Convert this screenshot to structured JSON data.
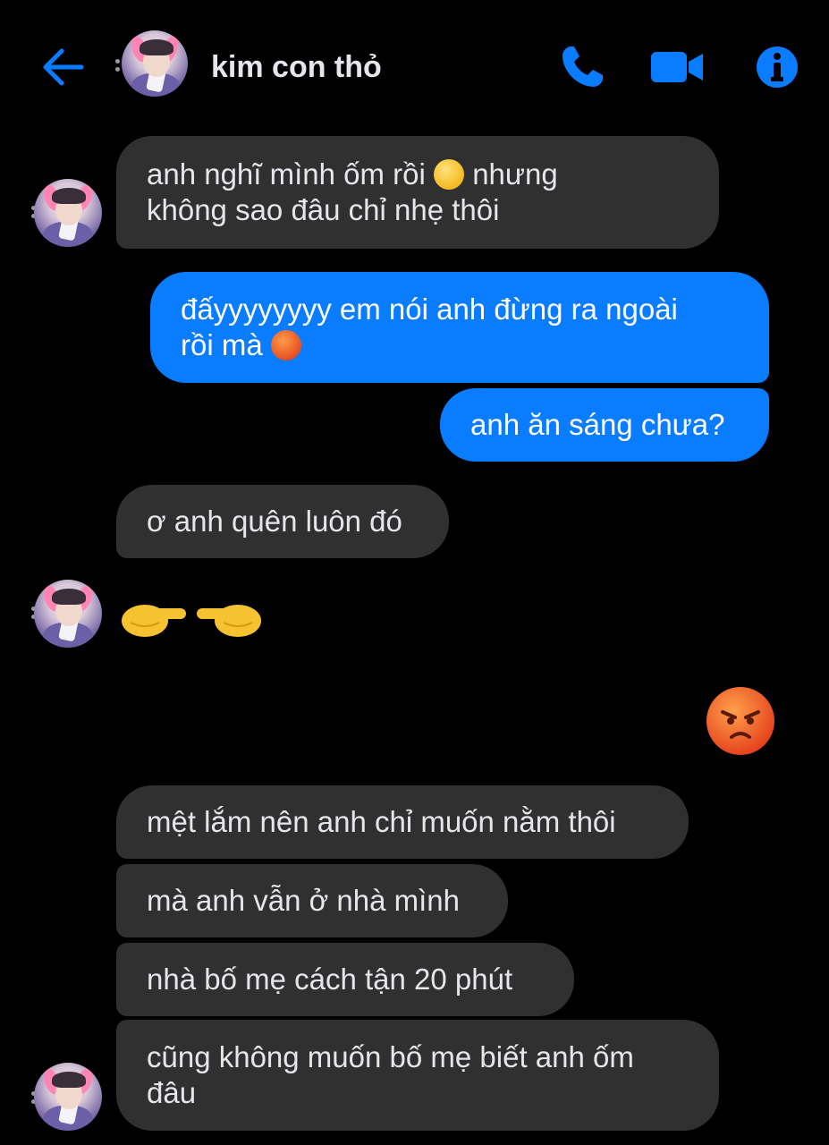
{
  "header": {
    "contact_name": "kim con thỏ",
    "accent_color": "#0a7cff",
    "icons": [
      "back-arrow-icon",
      "phone-icon",
      "video-camera-icon",
      "info-icon"
    ]
  },
  "messages": [
    {
      "sender": "contact",
      "text": "anh nghĩ mình ốm rồi",
      "emoji": "😣",
      "text_after": "nhưng\nkhông sao đâu chỉ nhẹ thôi"
    },
    {
      "sender": "me",
      "text": "đấyyyyyyyy em nói anh đừng ra ngoài\nrồi mà",
      "emoji": "😡"
    },
    {
      "sender": "me",
      "text": "anh ăn sáng chưa?"
    },
    {
      "sender": "contact",
      "text": "ơ anh quên luôn đó"
    },
    {
      "sender": "contact",
      "emoji_only": "👉👈"
    },
    {
      "sender": "me",
      "emoji_only": "😡"
    },
    {
      "sender": "contact",
      "text": "mệt lắm nên anh chỉ muốn nằm thôi"
    },
    {
      "sender": "contact",
      "text": "mà anh vẫn ở nhà mình"
    },
    {
      "sender": "contact",
      "text": "nhà bố mẹ cách tận 20 phút"
    },
    {
      "sender": "contact",
      "text": "cũng không muốn bố mẹ biết anh ốm\nđâu"
    }
  ],
  "colors": {
    "incoming_bubble": "#303030",
    "outgoing_bubble": "#0a7cff",
    "background": "#000000"
  }
}
